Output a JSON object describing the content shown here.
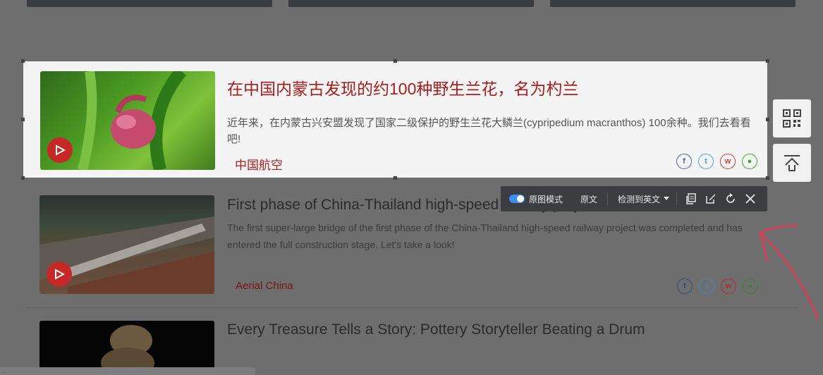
{
  "cards": [
    {
      "title": "在中国内蒙古发现的约100种野生兰花，名为杓兰",
      "description": "近年来，在内蒙古兴安盟发现了国家二级保护的野生兰花大鳞兰(cypripedium macranthos) 100余种。我们去看看吧!",
      "source": "中国航空"
    },
    {
      "title": "First phase of China-Thailand high-speed railway project",
      "description": "The first super-large bridge of the first phase of the China-Thailand high-speed railway project was completed and has entered the full construction stage. Let's take a look!",
      "source": "Aerial China"
    },
    {
      "title": "Every Treasure Tells a Story: Pottery Storyteller Beating a Drum"
    }
  ],
  "toolbar": {
    "mode_label": "原图模式",
    "original_label": "原文",
    "detect_label": "检测到英文"
  },
  "share_icons": [
    "facebook-icon",
    "twitter-icon",
    "weibo-icon",
    "wechat-icon"
  ],
  "status_url": "...",
  "colors": {
    "title_highlight": "#a51f1f",
    "toolbar_bg": "#3b3d40",
    "toggle_on": "#3d8ef0",
    "annotation": "#ff2a4f"
  }
}
